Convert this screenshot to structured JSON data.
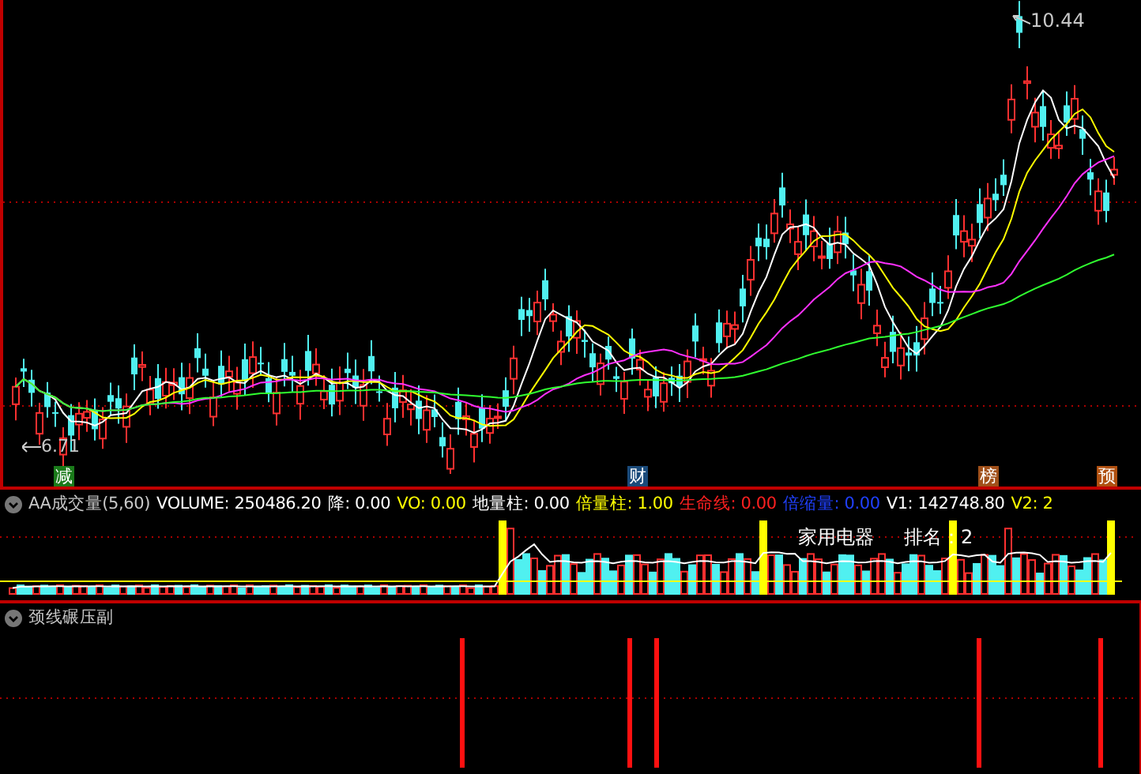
{
  "price_chart": {
    "high_label": "10.44",
    "low_label": "6.71",
    "event_markers": [
      {
        "label": "减",
        "color": "#1a7a1a"
      },
      {
        "label": "财",
        "color": "#1a4a7a"
      },
      {
        "label": "榜",
        "color": "#a0501a"
      },
      {
        "label": "预",
        "color": "#b05010"
      }
    ]
  },
  "volume_panel": {
    "title": "AA成交量(5,60)",
    "readouts": [
      {
        "label": "VOLUME:",
        "value": "250486.20",
        "color": "#ffffff"
      },
      {
        "label": "降:",
        "value": "0.00",
        "color": "#ffffff"
      },
      {
        "label": "VO:",
        "value": "0.00",
        "color": "#ffff00"
      },
      {
        "label": "地量柱:",
        "value": "0.00",
        "color": "#ffffff"
      },
      {
        "label": "倍量柱:",
        "value": "1.00",
        "color": "#ffff00"
      },
      {
        "label": "生命线:",
        "value": "0.00",
        "color": "#ff2020"
      },
      {
        "label": "倍缩量:",
        "value": "0.00",
        "color": "#2040ff"
      },
      {
        "label": "V1:",
        "value": "142748.80",
        "color": "#ffffff"
      },
      {
        "label": "V2:",
        "value": "2",
        "color": "#ffff00"
      }
    ],
    "sector": "家用电器",
    "rank": "排名：2"
  },
  "signal_panel": {
    "title": "颈线碾压副"
  }
}
